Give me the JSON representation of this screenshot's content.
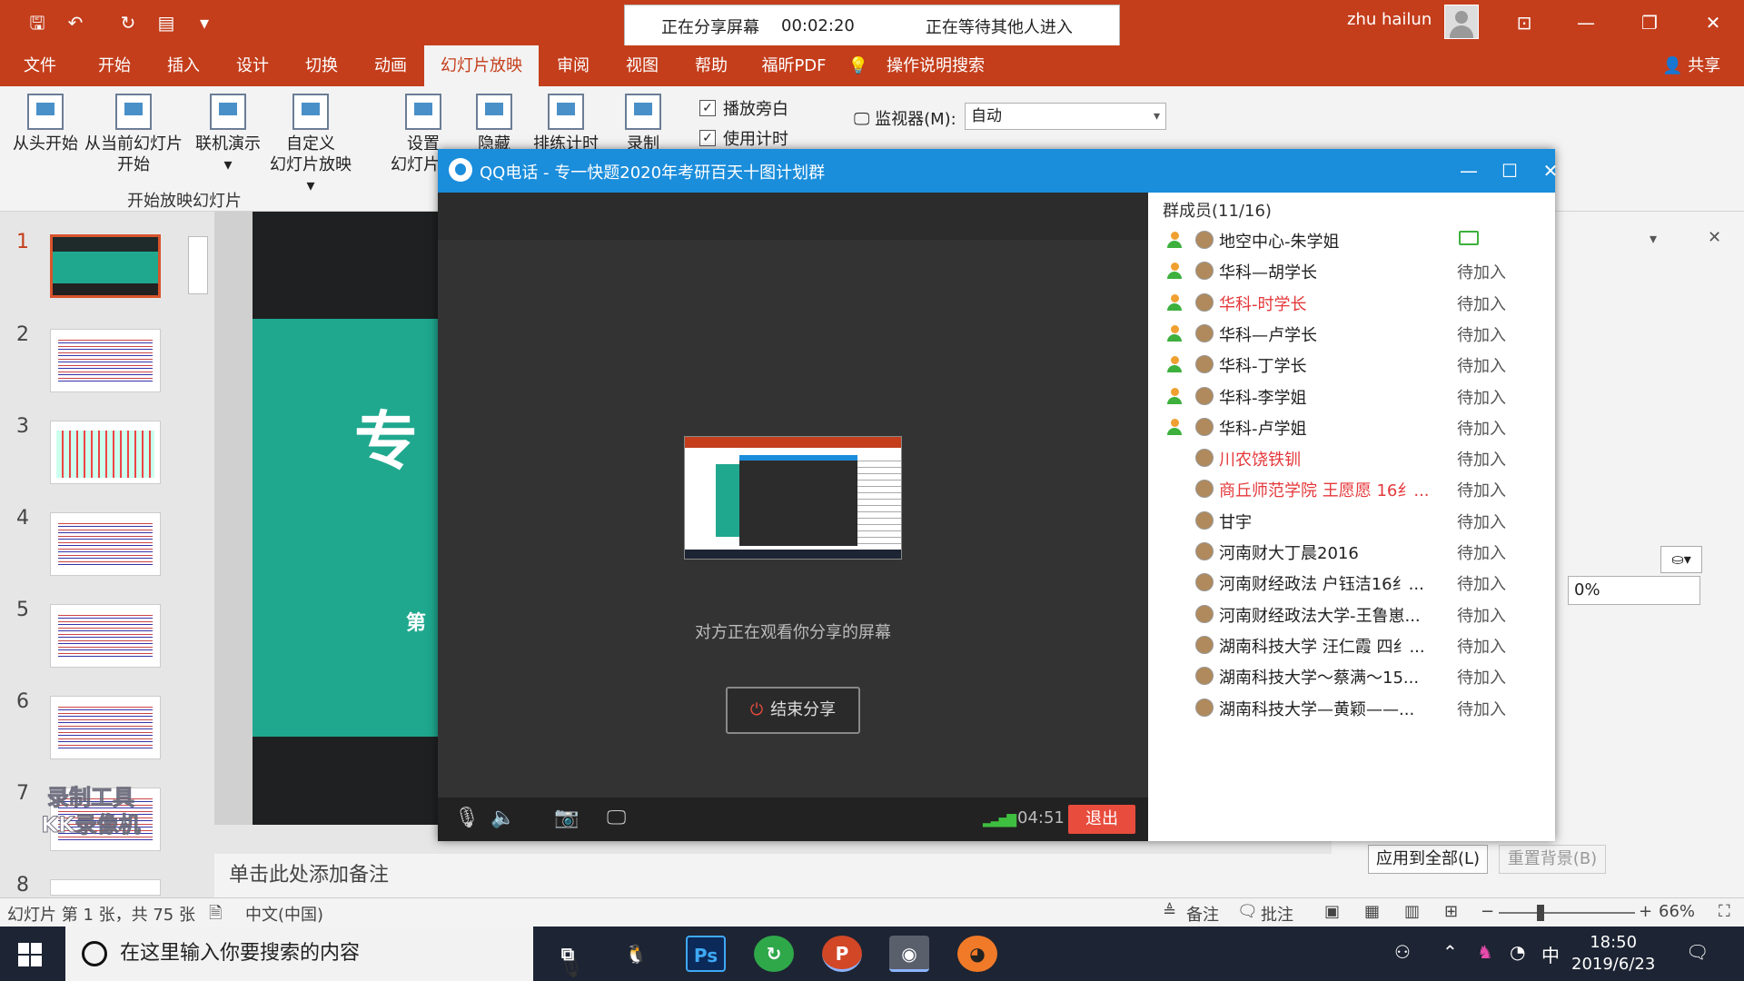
{
  "titlebar": {
    "share_status": "正在分享屏幕",
    "share_time": "00:02:20",
    "waiting_text": "正在等待其他人进入",
    "user_name": "zhu hailun"
  },
  "tabs": [
    {
      "label": "文件"
    },
    {
      "label": "开始"
    },
    {
      "label": "插入"
    },
    {
      "label": "设计"
    },
    {
      "label": "切换"
    },
    {
      "label": "动画"
    },
    {
      "label": "幻灯片放映"
    },
    {
      "label": "审阅"
    },
    {
      "label": "视图"
    },
    {
      "label": "帮助"
    },
    {
      "label": "福昕PDF"
    },
    {
      "label": "操作说明搜索"
    }
  ],
  "share_label": "共享",
  "ribbon": {
    "from_start": "从头开始",
    "from_current_1": "从当前幻灯片",
    "from_current_2": "开始",
    "online": "联机演示",
    "custom_1": "自定义",
    "custom_2": "幻灯片放映",
    "setup_1": "设置",
    "setup_2": "幻灯片放",
    "hide": "隐藏",
    "rehearse": "排练计时",
    "record": "录制",
    "group_label": "开始放映幻灯片",
    "play_narration": "播放旁白",
    "use_timings": "使用计时",
    "monitor_label": "监视器(M):",
    "monitor_value": "自动"
  },
  "thumbnails": {
    "numbers": [
      "1",
      "2",
      "3",
      "4",
      "5",
      "6",
      "7",
      "8"
    ],
    "watermark": "录制工具 KK录像机"
  },
  "slide": {
    "title_fragment": "专",
    "subtitle_fragment": "第"
  },
  "notes_placeholder": "单击此处添加备注",
  "right_pane": {
    "transparency_value": "0%",
    "apply_all": "应用到全部(L)",
    "reset_bg": "重置背景(B)"
  },
  "statusbar": {
    "slide_info": "幻灯片 第 1 张，共 75 张",
    "language": "中文(中国)",
    "notes": "备注",
    "comments": "批注",
    "zoom": "66%"
  },
  "taskbar": {
    "search_placeholder": "在这里输入你要搜索的内容",
    "ime": "中",
    "time": "18:50",
    "date": "2019/6/23"
  },
  "qq_window": {
    "title": "QQ电话 - 专一快题2020年考研百天十图计划群",
    "watch_text": "对方正在观看你分享的屏幕",
    "end_share": "结束分享",
    "call_time": "04:51",
    "quit": "退出",
    "members_header": "群成员(11/16)",
    "members": [
      {
        "name": "地空中心-朱学姐",
        "status": "",
        "sharing": true,
        "red": false,
        "joined": true
      },
      {
        "name": "华科—胡学长",
        "status": "待加入",
        "sharing": false,
        "red": false,
        "joined": true
      },
      {
        "name": "华科-时学长",
        "status": "待加入",
        "sharing": false,
        "red": true,
        "joined": true
      },
      {
        "name": "华科—卢学长",
        "status": "待加入",
        "sharing": false,
        "red": false,
        "joined": true
      },
      {
        "name": "华科-丁学长",
        "status": "待加入",
        "sharing": false,
        "red": false,
        "joined": true
      },
      {
        "name": "华科-李学姐",
        "status": "待加入",
        "sharing": false,
        "red": false,
        "joined": true
      },
      {
        "name": "华科-卢学姐",
        "status": "待加入",
        "sharing": false,
        "red": false,
        "joined": true
      },
      {
        "name": "川农饶铁钏",
        "status": "待加入",
        "sharing": false,
        "red": true,
        "joined": false
      },
      {
        "name": "商丘师范学院 王愿愿 16纟...",
        "status": "待加入",
        "sharing": false,
        "red": true,
        "joined": false
      },
      {
        "name": "甘宇",
        "status": "待加入",
        "sharing": false,
        "red": false,
        "joined": false
      },
      {
        "name": "河南财大丁晨2016",
        "status": "待加入",
        "sharing": false,
        "red": false,
        "joined": false
      },
      {
        "name": "河南财经政法 户钰洁16纟...",
        "status": "待加入",
        "sharing": false,
        "red": false,
        "joined": false
      },
      {
        "name": "河南财经政法大学-王鲁崽...",
        "status": "待加入",
        "sharing": false,
        "red": false,
        "joined": false
      },
      {
        "name": "湖南科技大学 汪仁霞 四纟...",
        "status": "待加入",
        "sharing": false,
        "red": false,
        "joined": false
      },
      {
        "name": "湖南科技大学～蔡满～15...",
        "status": "待加入",
        "sharing": false,
        "red": false,
        "joined": false
      },
      {
        "name": "湖南科技大学—黄颖——...",
        "status": "待加入",
        "sharing": false,
        "red": false,
        "joined": false
      }
    ]
  },
  "colors": {
    "accent": "#c43e1c",
    "qq_blue": "#1a8ddb",
    "quit_red": "#e84c3d"
  }
}
